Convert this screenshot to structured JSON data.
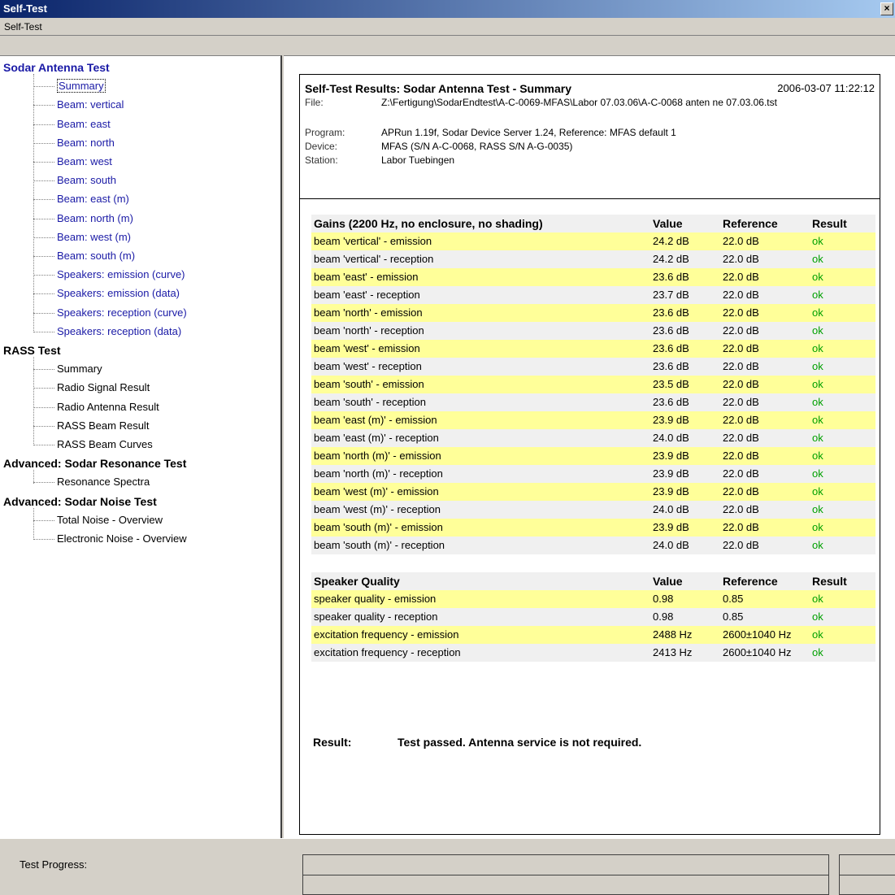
{
  "window": {
    "title": "Self-Test",
    "close_glyph": "×"
  },
  "menu": {
    "items": [
      "Self-Test"
    ]
  },
  "tree": {
    "groups": [
      {
        "label": "Sodar Antenna Test",
        "items": [
          "Summary",
          "Beam: vertical",
          "Beam: east",
          "Beam: north",
          "Beam: west",
          "Beam: south",
          "Beam: east (m)",
          "Beam: north (m)",
          "Beam: west (m)",
          "Beam: south (m)",
          "Speakers: emission (curve)",
          "Speakers: emission (data)",
          "Speakers: reception (curve)",
          "Speakers: reception (data)"
        ]
      },
      {
        "label": "RASS Test",
        "items": [
          "Summary",
          "Radio Signal Result",
          "Radio Antenna Result",
          "RASS Beam Result",
          "RASS Beam Curves"
        ]
      },
      {
        "label": "Advanced: Sodar Resonance Test",
        "items": [
          "Resonance Spectra"
        ]
      },
      {
        "label": "Advanced: Sodar Noise Test",
        "items": [
          "Total Noise - Overview",
          "Electronic Noise - Overview"
        ]
      }
    ],
    "selected": "Summary"
  },
  "report": {
    "title": "Self-Test Results: Sodar Antenna Test - Summary",
    "datetime": "2006-03-07 11:22:12",
    "meta": [
      {
        "label": "File:",
        "value": "Z:\\Fertigung\\SodarEndtest\\A-C-0069-MFAS\\Labor 07.03.06\\A-C-0068 anten ne 07.03.06.tst"
      },
      {
        "label": "Program:",
        "value": "APRun 1.19f, Sodar Device Server 1.24, Reference: MFAS default 1"
      },
      {
        "label": "Device:",
        "value": "MFAS (S/N A-C-0068, RASS S/N A-G-0035)"
      },
      {
        "label": "Station:",
        "value": "Labor Tuebingen"
      }
    ],
    "gains": {
      "header": [
        "Gains (2200 Hz, no enclosure, no shading)",
        "Value",
        "Reference",
        "Result"
      ],
      "rows": [
        [
          "beam 'vertical' - emission",
          "24.2 dB",
          "22.0 dB",
          "ok"
        ],
        [
          "beam 'vertical' - reception",
          "24.2 dB",
          "22.0 dB",
          "ok"
        ],
        [
          "beam 'east' - emission",
          "23.6 dB",
          "22.0 dB",
          "ok"
        ],
        [
          "beam 'east' - reception",
          "23.7 dB",
          "22.0 dB",
          "ok"
        ],
        [
          "beam 'north' - emission",
          "23.6 dB",
          "22.0 dB",
          "ok"
        ],
        [
          "beam 'north' - reception",
          "23.6 dB",
          "22.0 dB",
          "ok"
        ],
        [
          "beam 'west' - emission",
          "23.6 dB",
          "22.0 dB",
          "ok"
        ],
        [
          "beam 'west' - reception",
          "23.6 dB",
          "22.0 dB",
          "ok"
        ],
        [
          "beam 'south' - emission",
          "23.5 dB",
          "22.0 dB",
          "ok"
        ],
        [
          "beam 'south' - reception",
          "23.6 dB",
          "22.0 dB",
          "ok"
        ],
        [
          "beam 'east (m)' - emission",
          "23.9 dB",
          "22.0 dB",
          "ok"
        ],
        [
          "beam 'east (m)' - reception",
          "24.0 dB",
          "22.0 dB",
          "ok"
        ],
        [
          "beam 'north (m)' - emission",
          "23.9 dB",
          "22.0 dB",
          "ok"
        ],
        [
          "beam 'north (m)' - reception",
          "23.9 dB",
          "22.0 dB",
          "ok"
        ],
        [
          "beam 'west (m)' - emission",
          "23.9 dB",
          "22.0 dB",
          "ok"
        ],
        [
          "beam 'west (m)' - reception",
          "24.0 dB",
          "22.0 dB",
          "ok"
        ],
        [
          "beam 'south (m)' - emission",
          "23.9 dB",
          "22.0 dB",
          "ok"
        ],
        [
          "beam 'south (m)' - reception",
          "24.0 dB",
          "22.0 dB",
          "ok"
        ]
      ]
    },
    "speaker": {
      "header": [
        "Speaker Quality",
        "Value",
        "Reference",
        "Result"
      ],
      "rows": [
        [
          "speaker quality - emission",
          "0.98",
          "0.85",
          "ok"
        ],
        [
          "speaker quality - reception",
          "0.98",
          "0.85",
          "ok"
        ],
        [
          "excitation frequency - emission",
          "2488 Hz",
          "2600±1040 Hz",
          "ok"
        ],
        [
          "excitation frequency - reception",
          "2413 Hz",
          "2600±1040 Hz",
          "ok"
        ]
      ]
    },
    "result_label": "Result:",
    "result_text": "Test passed. Antenna service is not required."
  },
  "status": {
    "progress_label": "Test Progress:"
  },
  "colors": {
    "highlight_row": "#ffff99",
    "alt_row": "#f0f0f0",
    "ok": "#00a000",
    "link": "#1a1aa6",
    "title_bar": "#0a246a"
  }
}
